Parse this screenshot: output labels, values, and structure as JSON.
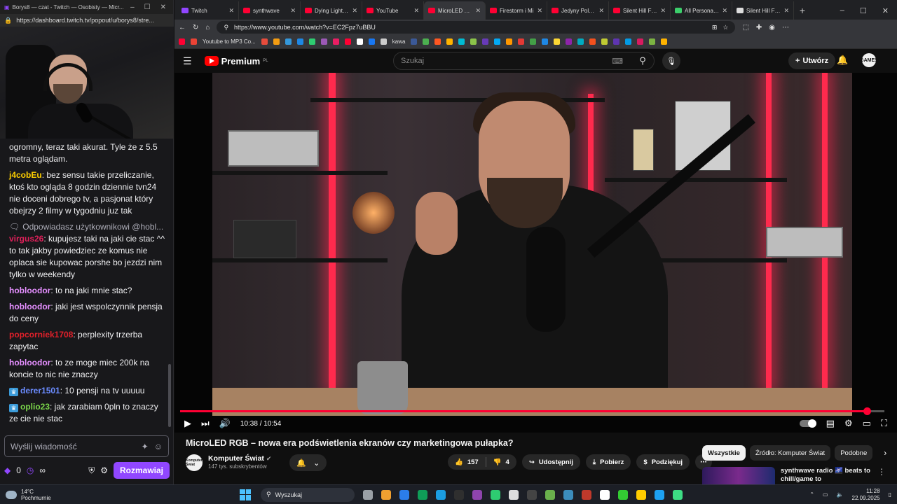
{
  "twitch": {
    "window_title": "Borys8 — czat - Twitch — Osobisty — Micr...",
    "url": "https://dashboard.twitch.tv/popout/u/borys8/stre...",
    "messages": [
      {
        "user": "",
        "text": "ogromny, teraz taki akurat. Tyle że z 5.5 metra oglądam.",
        "color": "#efeff1"
      },
      {
        "user": "j4cobEu",
        "text": ": bez sensu takie przeliczanie, ktoś kto ogląda 8 godzin dziennie tvn24 nie doceni dobrego tv, a pasjonat który obejrzy 2 filmy w tygodniu juz tak",
        "color": "#ffd000"
      },
      {
        "reply": "Odpowiadasz użytkownikowi @hobl...",
        "user": "virgus26",
        "text": ": kupujesz taki na jaki cie stac ^^ to tak jakby powiedziec ze komus nie oplaca sie kupowac porshe bo jezdzi nim tylko w weekendy",
        "color": "#e0205a"
      },
      {
        "user": "hobloodor",
        "text": ": to na jaki mnie stac?",
        "color": "#e58fff"
      },
      {
        "user": "hobloodor",
        "text": ": jaki jest wspolczynnik pensja do ceny",
        "color": "#e58fff"
      },
      {
        "user": "popcorniek1708",
        "text": ": perplexity trzerba zapytac",
        "color": "#e0202a"
      },
      {
        "user": "hobloodor",
        "text": ": to ze moge miec 200k na koncie to nic nie znaczy",
        "color": "#e58fff"
      },
      {
        "user": "derer1501",
        "text": ": 10 pensji na tv uuuuu",
        "color": "#6b8cff",
        "badge": true
      },
      {
        "user": "oplio23",
        "text": ": jak zarabiam 0pln to znaczy ze cie nie stac",
        "color": "#7bd64b",
        "badge": true
      }
    ],
    "input_placeholder": "Wyślij wiadomość",
    "points": "0",
    "infinity": "∞",
    "chat_button": "Rozmawiaj"
  },
  "browser": {
    "tabs": [
      {
        "label": "Twitch",
        "color": "#9146ff",
        "active": false
      },
      {
        "label": "synthwave",
        "color": "#ff0033",
        "active": false
      },
      {
        "label": "Dying Light po",
        "color": "#ff0033",
        "active": false
      },
      {
        "label": "YouTube",
        "color": "#ff0033",
        "active": false
      },
      {
        "label": "MicroLED RGB",
        "color": "#ff0033",
        "active": true
      },
      {
        "label": "Firestorm i Mi",
        "color": "#ff0033",
        "active": false
      },
      {
        "label": "Jedyny Polak s",
        "color": "#ff0033",
        "active": false
      },
      {
        "label": "Silent Hill F Re",
        "color": "#ff0033",
        "active": false
      },
      {
        "label": "All Personal Fe",
        "color": "#3ccf6b",
        "active": false
      },
      {
        "label": "Silent Hill F Rev",
        "color": "#dddddd",
        "active": false
      }
    ],
    "new_tab": "+",
    "url": "https://www.youtube.com/watch?v=EC2Fpz7uBBU",
    "bookmark_label": "Youtube to MP3 Co...",
    "bookmark_label2": "kawa",
    "bookmark_colors": [
      "#e74c3c",
      "#f39c12",
      "#3498db",
      "#1e88e5",
      "#2ecc71",
      "#9b59b6",
      "#e91e63",
      "#ff0033",
      "#ffffff",
      "#1877f2",
      "#cccccc",
      "#3b5998",
      "#4caf50",
      "#ff5722",
      "#ffb300",
      "#00bcd4",
      "#8bc34a",
      "#673ab7",
      "#03a9f4",
      "#ff9800",
      "#e53935",
      "#43a047",
      "#1e88e5",
      "#fdd835",
      "#8e24aa",
      "#00acc1",
      "#f4511e",
      "#c0ca33",
      "#5e35b1",
      "#039be5",
      "#d81b60",
      "#7cb342",
      "#ffb300"
    ]
  },
  "youtube": {
    "brand": "Premium",
    "region": "PL",
    "search_placeholder": "Szukaj",
    "create_label": "Utwórz",
    "avatar_text": "GAMES",
    "time": "10:38 / 10:54",
    "progress": 0.975,
    "title": "MicroLED RGB – nowa era podświetlenia ekranów czy marketingowa pułapka?",
    "channel_name": "Komputer Świat",
    "channel_avatar": "Komputer Świat",
    "subscribers": "147 tys. subskrybentów",
    "likes": "157",
    "dislikes": "4",
    "share": "Udostępnij",
    "download": "Pobierz",
    "thanks": "Podziękuj",
    "chips": [
      "Wszystkie",
      "Źródło: Komputer Świat",
      "Podobne"
    ],
    "rec_title": "synthwave radio 🌌 beats to chill/game to"
  },
  "taskbar": {
    "temp": "14°C",
    "weather": "Pochmurnie",
    "search": "Wyszukaj",
    "time": "11:28",
    "date": "22.09.2025",
    "app_colors": [
      "#9aa0a6",
      "#f0a030",
      "#2b7de9",
      "#0f9d58",
      "#1b9de2",
      "#2f2f2f",
      "#8e44ad",
      "#2ecc71",
      "#dddddd",
      "#444444",
      "#6ab04c",
      "#3c8dbc",
      "#c0392b",
      "#ffffff",
      "#33cc33",
      "#ffcc00",
      "#1da1f2",
      "#3ddc84"
    ]
  }
}
